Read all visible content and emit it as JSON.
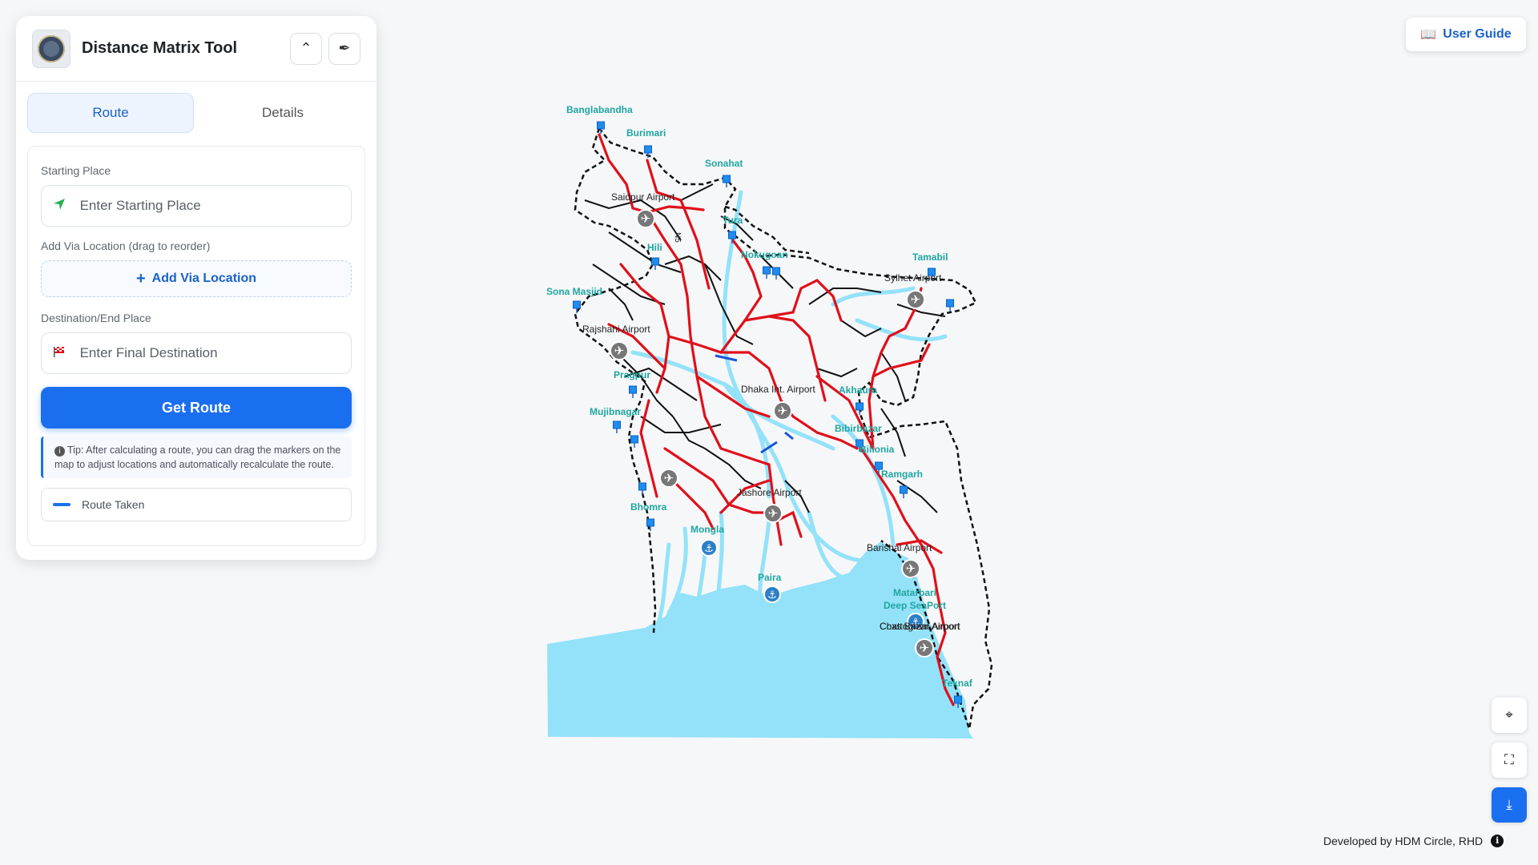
{
  "panel": {
    "title": "Distance Matrix Tool",
    "tabs": [
      "Route",
      "Details"
    ],
    "active_tab": "Route",
    "starting_label": "Starting Place",
    "starting_placeholder": "Enter Starting Place",
    "via_label": "Add Via Location (drag to reorder)",
    "add_via": "Add Via Location",
    "destination_label": "Destination/End Place",
    "destination_placeholder": "Enter Final Destination",
    "get_route": "Get Route",
    "tip": "Tip: After calculating a route, you can drag the markers on the map to adjust locations and automatically recalculate the route.",
    "legend_route": "Route Taken"
  },
  "user_guide": "User Guide",
  "footer": "Developed by HDM Circle, RHD",
  "colors": {
    "accent": "#1a6ff0",
    "national_highway": "#e0101a",
    "border_label": "#1fa6a0",
    "water": "#93e2f9"
  },
  "map": {
    "land_ports": [
      "Banglabandha",
      "Burimari",
      "Sonahat",
      "Tura",
      "Hili",
      "Nokugoan",
      "Tamabil",
      "Sona Masjid",
      "Pragpur",
      "Akhaura",
      "Mujibnagar",
      "Bibirbazar",
      "Bilionia",
      "Ramgarh",
      "Bhomra",
      "Mongla",
      "Paira",
      "Matarbari",
      "Deep SeaPort",
      "Teknaf"
    ],
    "airports": [
      "Saidpur Airport",
      "Sylhet Airport",
      "Rajshahi Airport",
      "Dhaka Int. Airport",
      "Jashore Airport",
      "Barishal Airport",
      "Chattogram Airport",
      "Coxs Bazar Airport"
    ],
    "road_label": "N5"
  }
}
